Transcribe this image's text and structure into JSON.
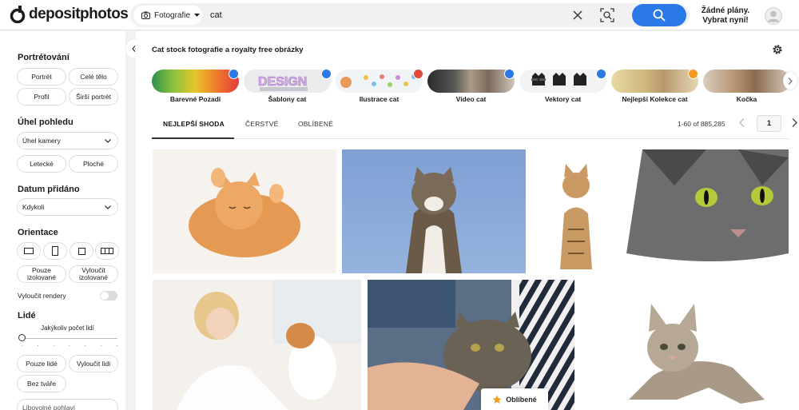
{
  "header": {
    "logo_text": "depositphotos",
    "search_type": "Fotografie",
    "search_value": "cat",
    "plans_line1": "Žádné plány.",
    "plans_line2": "Vybrat nyní!"
  },
  "sidebar": {
    "portrait_title": "Portrétování",
    "portrait_options": [
      "Portrét",
      "Celé tělo",
      "Profil",
      "Širší portrét"
    ],
    "view_angle_title": "Úhel pohledu",
    "camera_angle_select": "Úhel kamery",
    "view_options": [
      "Letecké",
      "Ploché"
    ],
    "date_title": "Datum přidáno",
    "date_select": "Kdykoli",
    "orientation_title": "Orientace",
    "isolation_options": [
      "Pouze izolované",
      "Vyloučit izolované"
    ],
    "exclude_renders_label": "Vyloučit rendery",
    "people_title": "Lidé",
    "people_count_label": "Jakýkoliv počet lidí",
    "people_options": [
      "Pouze lidé",
      "Vyloučit lidi",
      "Bez tváře"
    ],
    "bottom_select": "Libovolné pohlaví"
  },
  "main": {
    "page_title": "Cat stock fotografie a royalty free obrázky",
    "categories": [
      {
        "label": "Barevné Pozadí",
        "badge_color": "#2a79e6"
      },
      {
        "label": "Šablony cat",
        "badge_color": "#2a79e6"
      },
      {
        "label": "Ilustrace cat",
        "badge_color": "#e14b3b"
      },
      {
        "label": "Video cat",
        "badge_color": "#2a79e6"
      },
      {
        "label": "Vektory cat",
        "badge_color": "#2a79e6"
      },
      {
        "label": "Nejlepší Kolekce cat",
        "badge_color": "#f39a1e"
      },
      {
        "label": "Kočka",
        "badge_color": ""
      }
    ],
    "tabs": [
      "NEJLEPŠÍ SHODA",
      "ČERSTVÉ",
      "OBLÍBENÉ"
    ],
    "results_count": "1-60 of 885,285",
    "current_page": "1",
    "favorites_label": "Oblíbené"
  },
  "colors": {
    "accent": "#2a79e6",
    "favorite_star": "#f39a1e"
  }
}
